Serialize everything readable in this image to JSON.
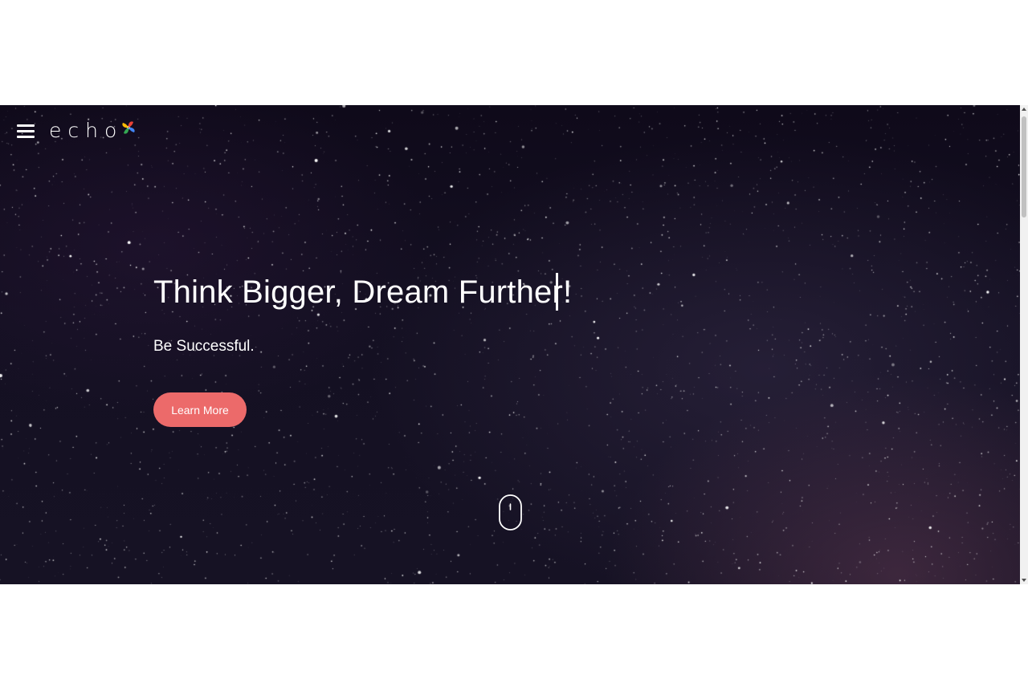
{
  "brand": {
    "name": "echo",
    "logo_icon": "pinwheel-logo-icon",
    "logo_colors": [
      "#e94235",
      "#fbbc05",
      "#34a853",
      "#4285f4"
    ]
  },
  "nav": {
    "menu_icon": "hamburger-menu-icon"
  },
  "hero": {
    "headline": "Think Bigger, Dream Further!",
    "subtitle": "Be Successful.",
    "cta_label": "Learn More",
    "scroll_icon": "mouse-scroll-icon",
    "background": "starry-night-sky"
  },
  "colors": {
    "accent": "#ec6a6a",
    "text": "#ffffff",
    "background_dark": "#120d1c"
  }
}
